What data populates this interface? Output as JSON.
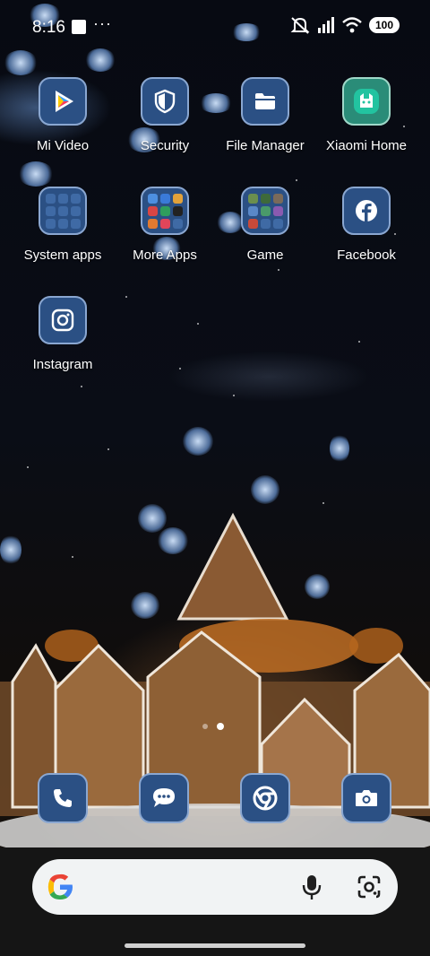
{
  "status_bar": {
    "time": "8:16",
    "overflow": "···",
    "battery": "100",
    "icons": [
      "notification-square-icon",
      "mute-icon",
      "signal-icon",
      "wifi-icon",
      "battery-icon"
    ]
  },
  "home": {
    "row1": [
      {
        "label": "Mi Video",
        "icon": "mi-video-icon"
      },
      {
        "label": "Security",
        "icon": "security-shield-icon"
      },
      {
        "label": "File Manager",
        "icon": "folder-icon"
      },
      {
        "label": "Xiaomi Home",
        "icon": "xiaomi-home-icon"
      }
    ],
    "row2": [
      {
        "label": "System apps",
        "icon": "folder-system-apps"
      },
      {
        "label": "More Apps",
        "icon": "folder-more-apps"
      },
      {
        "label": "Game",
        "icon": "folder-game"
      },
      {
        "label": "Facebook",
        "icon": "facebook-icon"
      }
    ],
    "row3": [
      {
        "label": "Instagram",
        "icon": "instagram-icon"
      }
    ]
  },
  "dock": [
    {
      "icon": "phone-icon"
    },
    {
      "icon": "messages-icon"
    },
    {
      "icon": "chrome-icon"
    },
    {
      "icon": "camera-icon"
    }
  ],
  "page_indicator": {
    "pages": 2,
    "active": 2
  },
  "search_bar": {
    "icons": [
      "google-logo-icon",
      "microphone-icon",
      "lens-icon"
    ]
  },
  "colors": {
    "tile_bg": "#2b5084",
    "tile_border": "#8aa7d1"
  }
}
